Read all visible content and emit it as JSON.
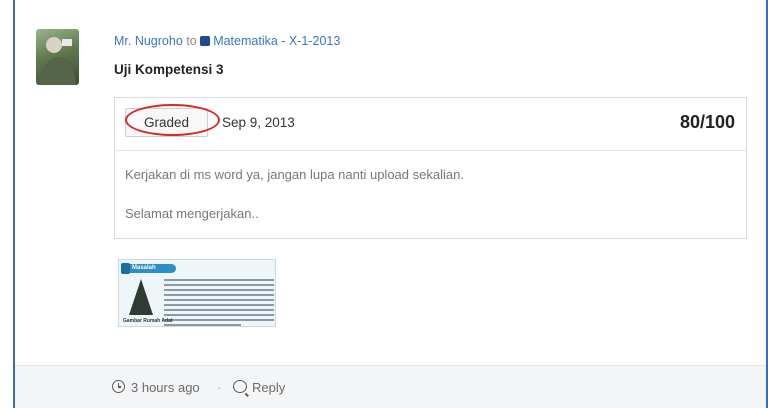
{
  "post": {
    "author": "Mr. Nugroho",
    "to_word": "to",
    "group": "Matematika - X-1-2013",
    "title": "Uji Kompetensi 3"
  },
  "grade": {
    "badge": "Graded",
    "date": "Sep 9, 2013",
    "score": "80/100",
    "message_lines": [
      "Kerjakan di ms word ya, jangan lupa nanti upload sekalian.",
      "Selamat mengerjakan.."
    ]
  },
  "attachment": {
    "tag": "Masalah",
    "caption": "Gambar   Rumah Adat"
  },
  "footer": {
    "time": "3 hours ago",
    "separator": "·",
    "reply": "Reply"
  },
  "icons": {
    "group": "group-square-icon",
    "clock": "clock-icon",
    "reply": "comment-bubble-icon"
  },
  "colors": {
    "link": "#3a75c4",
    "frame": "#3a6db3",
    "highlight": "#d62b2b"
  }
}
